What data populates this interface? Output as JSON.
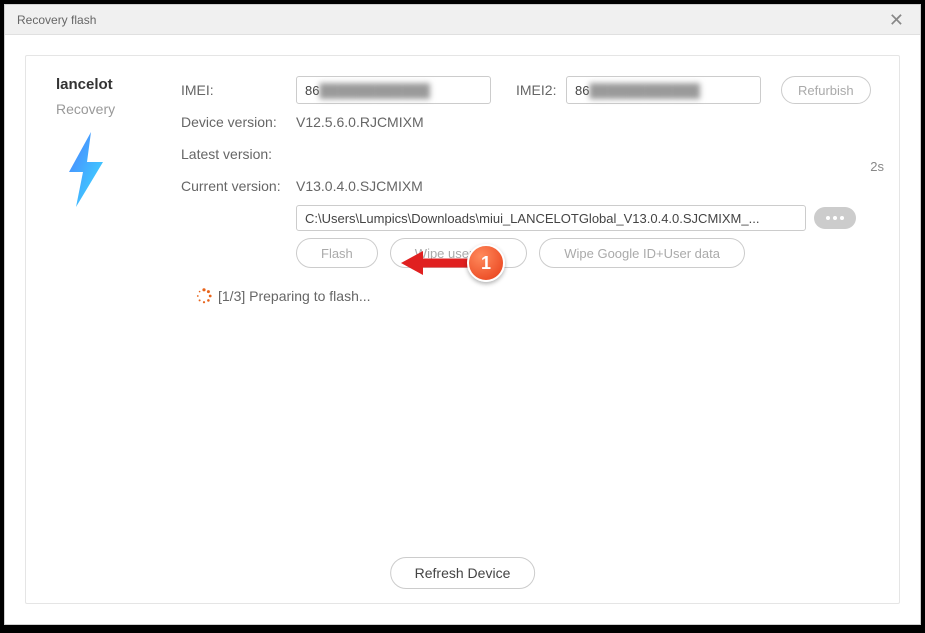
{
  "window": {
    "title": "Recovery flash"
  },
  "device": {
    "name": "lancelot",
    "mode": "Recovery"
  },
  "fields": {
    "imei_label": "IMEI:",
    "imei_value": "86",
    "imei2_label": "IMEI2:",
    "imei2_value": "86",
    "device_version_label": "Device version:",
    "device_version_value": "V12.5.6.0.RJCMIXM",
    "latest_version_label": "Latest version:",
    "latest_version_value": "",
    "current_version_label": "Current version:",
    "current_version_value": "V13.0.4.0.SJCMIXM",
    "path_value": "C:\\Users\\Lumpics\\Downloads\\miui_LANCELOTGlobal_V13.0.4.0.SJCMIXM_..."
  },
  "buttons": {
    "refurbish": "Refurbish",
    "flash": "Flash",
    "wipe_user": "Wipe user data",
    "wipe_google": "Wipe Google ID+User data",
    "refresh": "Refresh Device"
  },
  "status": {
    "text": "[1/3] Preparing to flash..."
  },
  "timer": "2s",
  "annotation": {
    "badge": "1"
  }
}
